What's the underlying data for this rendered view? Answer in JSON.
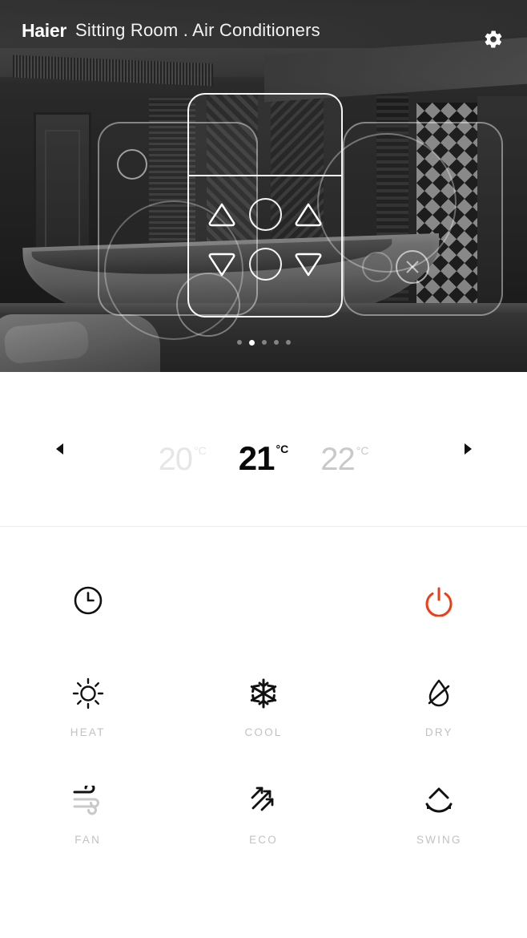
{
  "header": {
    "brand": "Haier",
    "title": "Sitting Room . Air Conditioners",
    "settings_icon": "gear-icon"
  },
  "hero": {
    "carousel": {
      "total_dots": 5,
      "active_index": 1,
      "cards": [
        {
          "position": "left",
          "icon": "device-outline-circles"
        },
        {
          "position": "center",
          "icon": "remote-control-keypad",
          "selected": true
        },
        {
          "position": "right",
          "icon": "device-outline-circle-x"
        }
      ],
      "center_buttons": [
        "triangle-up",
        "circle",
        "triangle-up",
        "triangle-down",
        "circle",
        "triangle-down"
      ]
    }
  },
  "temperature": {
    "prev_arrow": "triangle-left-icon",
    "next_arrow": "triangle-right-icon",
    "unit": "°C",
    "selected": "21",
    "options": [
      {
        "value": "20",
        "unit": "°C",
        "state": "prev"
      },
      {
        "value": "21",
        "unit": "°C",
        "state": "selected"
      },
      {
        "value": "22",
        "unit": "°C",
        "state": "next"
      }
    ]
  },
  "controls": {
    "timer": {
      "label": "",
      "icon": "clock-icon",
      "color": "#111111"
    },
    "power": {
      "label": "",
      "icon": "power-icon",
      "color": "#F03C15"
    },
    "modes": [
      {
        "id": "heat",
        "label": "HEAT",
        "icon": "sun-icon"
      },
      {
        "id": "cool",
        "label": "COOL",
        "icon": "snowflake-icon"
      },
      {
        "id": "dry",
        "label": "DRY",
        "icon": "droplet-slash-icon"
      },
      {
        "id": "fan",
        "label": "FAN",
        "icon": "wind-icon"
      },
      {
        "id": "eco",
        "label": "ECO",
        "icon": "eco-arrows-icon"
      },
      {
        "id": "swing",
        "label": "SWING",
        "icon": "swing-arc-icon"
      }
    ]
  },
  "colors": {
    "power_accent": "#F03C15",
    "label_gray": "#C2C2C2",
    "icon_black": "#111111",
    "divider": "#EDEDED"
  }
}
